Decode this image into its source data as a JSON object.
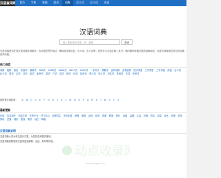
{
  "site": {
    "logo": "汉语查词网"
  },
  "nav": [
    {
      "label": "首页"
    },
    {
      "label": "字典"
    },
    {
      "label": "笔顺"
    },
    {
      "label": "组词"
    },
    {
      "label": "词典",
      "active": true
    },
    {
      "label": "近义词"
    },
    {
      "label": "反义词"
    },
    {
      "label": "成语"
    }
  ],
  "page": {
    "title": "汉语词典",
    "search_placeholder": "输入要查询的词语，如：美丽",
    "search_button": "查询",
    "intro": "汉语词典提供在线汉语词典查询服务，查词语意思的用法、解释及词语出处、近义词、反义词等，是您学习汉语必备工具书，随时随地掌握词语的准确用法，欢迎大家使用在线汉语词典查询功能。"
  },
  "sections": {
    "topics": {
      "title": "热门词类",
      "items": [
        "动物",
        "植物",
        "颜色",
        "形容词",
        "数量词",
        "ABB式",
        "AABB式",
        "ABAB式",
        "ABCC式",
        "AABC式",
        "一字开头",
        "带数字",
        "含有动物",
        "含有植物",
        "四字词语",
        "三字词语",
        "二字词语",
        "成语",
        "近义词",
        "反义词",
        "叠词",
        "名词",
        "动词",
        "副词",
        "象声词",
        "量词",
        "介词",
        "连词",
        "助词",
        "代词",
        "拟声词",
        "褒义词",
        "贬义词",
        "中性词",
        "多音词",
        "古词",
        "外来词"
      ]
    },
    "letters": {
      "label": "按拼音字母检索：",
      "items": [
        "A",
        "B",
        "C",
        "D",
        "E",
        "F",
        "G",
        "H",
        "J",
        "K",
        "L",
        "M",
        "N",
        "O",
        "P",
        "Q",
        "R",
        "S",
        "T",
        "W",
        "X",
        "Y",
        "Z"
      ]
    },
    "recent": {
      "title": "最新更新",
      "items": [
        "比较",
        "坐井观天",
        "无精打采",
        "无所不为",
        "开门见山",
        "全神贯注",
        "天衣无缝",
        "骄傲",
        "美丽",
        "善良",
        "勤劳",
        "勇敢",
        "聪明",
        "快乐",
        "幸福",
        "温暖",
        "认真",
        "仔细",
        "热情",
        "自豪",
        "伟大",
        "珍惜",
        "欣赏",
        "感动",
        "坚强",
        "诚实",
        "宽容",
        "美好",
        "灿烂",
        "辉煌"
      ]
    },
    "about": {
      "title": "汉语词典说明",
      "lines": [
        "汉语词典以词为单位进行汇集，为您的查询提供便利。",
        "汉语词典收集常用汉语词语及解释、出处、例句等内容。"
      ]
    }
  },
  "watermark": {
    "text": "动点收录网",
    "sub": "www.yyxxgjywl.com"
  }
}
